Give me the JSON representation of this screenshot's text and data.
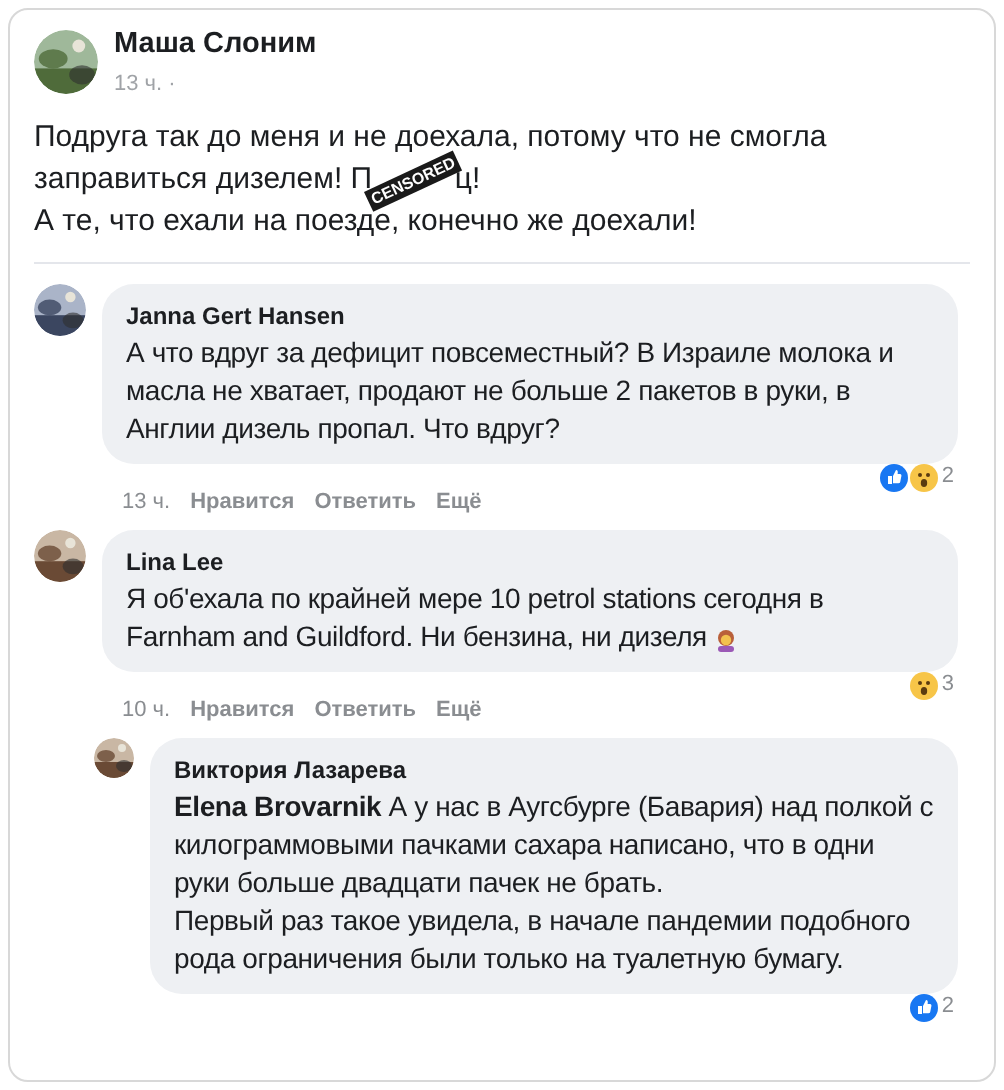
{
  "post": {
    "author": "Маша Слоним",
    "time": "13 ч. ·",
    "paragraphs": [
      [
        {
          "kind": "text",
          "text": "Подруга так до меня и не доехала, потому что не смогла заправиться дизелем! П"
        },
        {
          "kind": "censored",
          "text": "CENSORED"
        },
        {
          "kind": "text",
          "text": "ц!"
        }
      ],
      [
        {
          "kind": "text",
          "text": "А те, что ехали на поезде, конечно же доехали!"
        }
      ]
    ]
  },
  "comments": [
    {
      "author": "Janna Gert Hansen",
      "paragraphs": [
        "А что вдруг за дефицит повсеместный? В Израиле молока и масла не хватает, продают не больше 2 пакетов в руки, в Англии дизель пропал. Что вдруг?"
      ],
      "reactions": [
        {
          "kind": "like"
        },
        {
          "kind": "wow"
        }
      ],
      "reaction_count": "2",
      "time": "13 ч.",
      "actions": [
        "Нравится",
        "Ответить",
        "Ещё"
      ]
    },
    {
      "author": "Lina Lee",
      "paragraphs": [
        "Я об'ехала по крайней мере 10 petrol stations сегодня в Farnham and Guildford. Ни бензина, ни дизеля"
      ],
      "emoji": true,
      "reactions": [
        {
          "kind": "wow"
        }
      ],
      "reaction_count": "3",
      "time": "10 ч.",
      "actions": [
        "Нравится",
        "Ответить",
        "Ещё"
      ],
      "replies": [
        {
          "author": "Виктория Лазарева",
          "paragraphs": [
            "**Elena Brovarnik** А у нас в Аугсбурге (Бавария) над полкой с килограммовыми пачками сахара написано, что в одни руки больше двадцати пачек не брать.",
            "Первый раз такое увидела, в начале пандемии подобного рода ограничения были только на туалетную бумагу."
          ],
          "reactions": [
            {
              "kind": "like"
            }
          ],
          "reaction_count": "2"
        }
      ]
    }
  ]
}
